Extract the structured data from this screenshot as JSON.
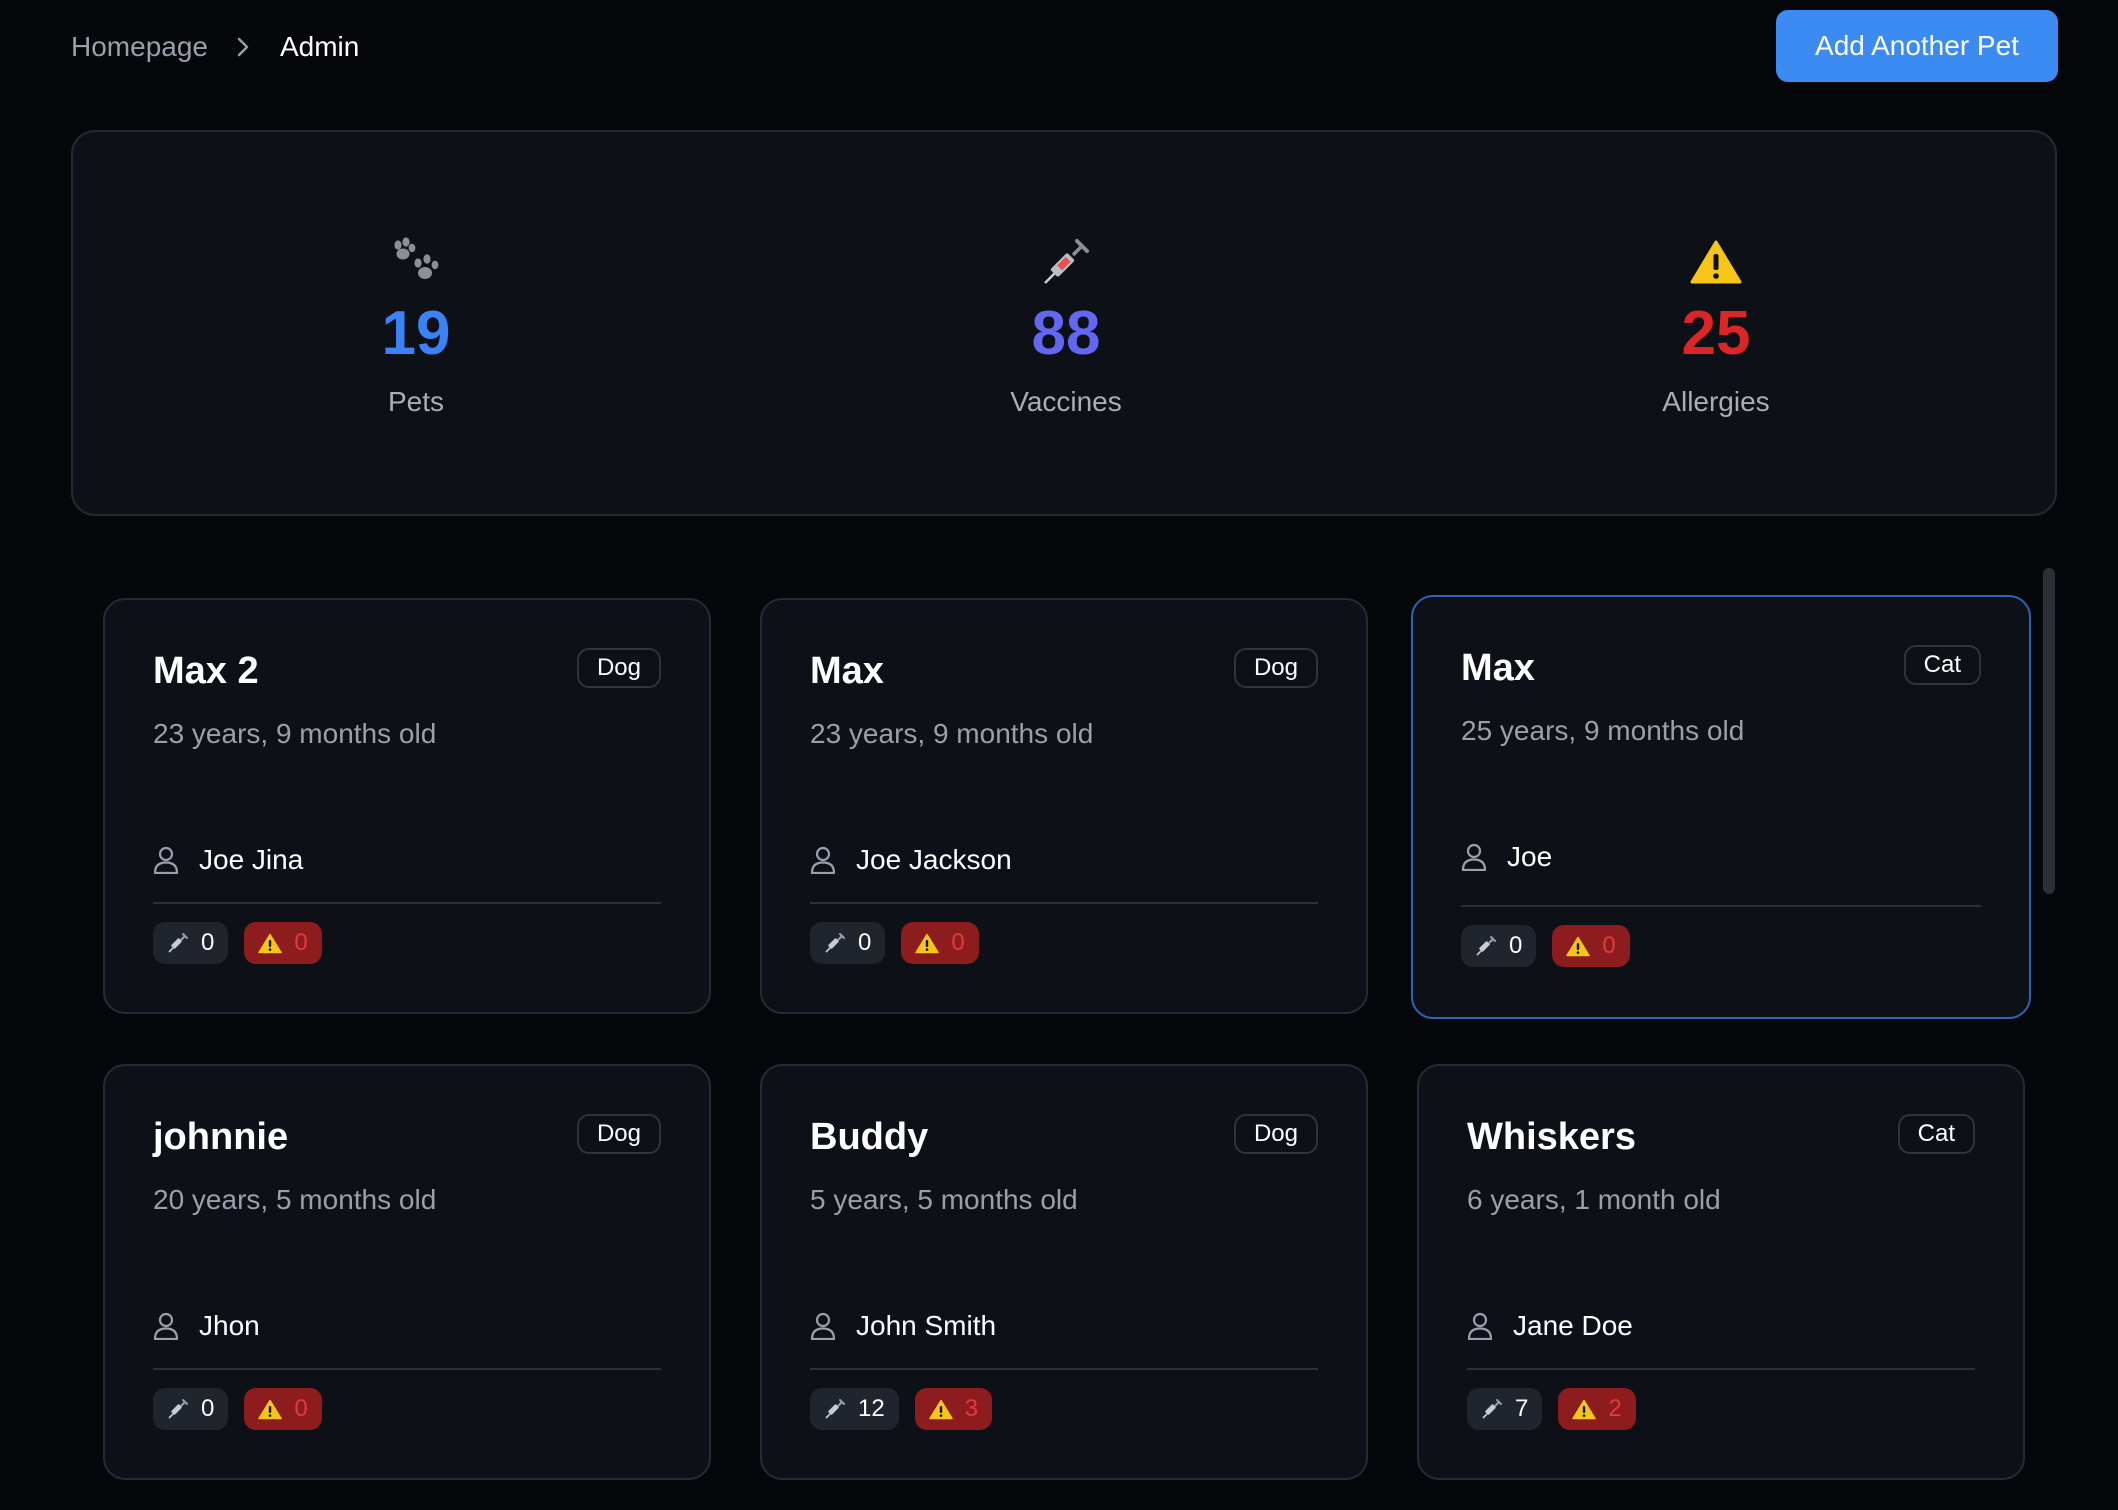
{
  "breadcrumb": {
    "home": "Homepage",
    "separator_icon": "chevron-right-icon",
    "current": "Admin"
  },
  "header": {
    "add_button": "Add Another Pet"
  },
  "stats": {
    "pets": {
      "icon": "paw-icon",
      "value": "19",
      "label": "Pets",
      "color": "#3b82f6"
    },
    "vaccines": {
      "icon": "syringe-icon",
      "value": "88",
      "label": "Vaccines",
      "color": "#6366f1"
    },
    "allergies": {
      "icon": "warning-icon",
      "value": "25",
      "label": "Allergies",
      "color": "#dc2626"
    }
  },
  "pets": [
    {
      "name": "Max 2",
      "type": "Dog",
      "age": "23 years, 9 months old",
      "owner": "Joe Jina",
      "vaccines": "0",
      "allergies": "0"
    },
    {
      "name": "Max",
      "type": "Dog",
      "age": "23 years, 9 months old",
      "owner": "Joe Jackson",
      "vaccines": "0",
      "allergies": "0"
    },
    {
      "name": "Max",
      "type": "Cat",
      "age": "25 years, 9 months old",
      "owner": "Joe",
      "vaccines": "0",
      "allergies": "0"
    },
    {
      "name": "johnnie",
      "type": "Dog",
      "age": "20 years, 5 months old",
      "owner": "Jhon",
      "vaccines": "0",
      "allergies": "0"
    },
    {
      "name": "Buddy",
      "type": "Dog",
      "age": "5 years, 5 months old",
      "owner": "John Smith",
      "vaccines": "12",
      "allergies": "3"
    },
    {
      "name": "Whiskers",
      "type": "Cat",
      "age": "6 years, 1 month old",
      "owner": "Jane Doe",
      "vaccines": "7",
      "allergies": "2"
    }
  ],
  "colors": {
    "accent": "#3b8bf3",
    "allergy_pill_bg": "#8d1c1f",
    "allergy_text": "#e23b3b",
    "selected_border": "#2c63b5"
  }
}
